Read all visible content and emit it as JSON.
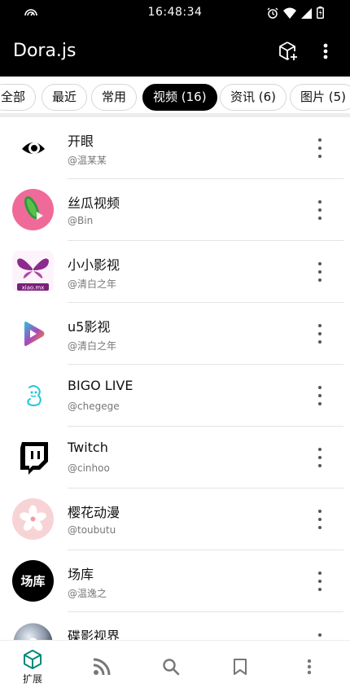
{
  "status_bar": {
    "time": "16:48:34"
  },
  "app_bar": {
    "title": "Dora.js",
    "cube_icon": "cube-plus-icon",
    "more_icon": "more-vert-icon"
  },
  "filters": [
    {
      "label": "全部",
      "active": false
    },
    {
      "label": "最近",
      "active": false
    },
    {
      "label": "常用",
      "active": false
    },
    {
      "label": "视频 (16)",
      "active": true
    },
    {
      "label": "资讯 (6)",
      "active": false
    },
    {
      "label": "图片 (5)",
      "active": false
    }
  ],
  "extensions": [
    {
      "name": "开眼",
      "author": "@温某某",
      "icon": "eye-logo"
    },
    {
      "name": "丝瓜视频",
      "author": "@Bin",
      "icon": "loofah-logo"
    },
    {
      "name": "小小影视",
      "author": "@清白之年",
      "icon": "butterfly-logo"
    },
    {
      "name": "u5影视",
      "author": "@清白之年",
      "icon": "play-gradient-logo"
    },
    {
      "name": "BIGO LIVE",
      "author": "@chegege",
      "icon": "bigo-logo"
    },
    {
      "name": "Twitch",
      "author": "@cinhoo",
      "icon": "twitch-logo"
    },
    {
      "name": "樱花动漫",
      "author": "@toubutu",
      "icon": "sakura-logo"
    },
    {
      "name": "场库",
      "author": "@温逸之",
      "icon": "changku-logo",
      "logo_text": "场库"
    },
    {
      "name": "碟影视界",
      "author": "",
      "icon": "disc-logo"
    }
  ],
  "bottom_nav": [
    {
      "label": "扩展",
      "icon": "extension-cube-icon",
      "active": true
    },
    {
      "label": "",
      "icon": "rss-icon",
      "active": false
    },
    {
      "label": "",
      "icon": "search-icon",
      "active": false
    },
    {
      "label": "",
      "icon": "bookmark-icon",
      "active": false
    },
    {
      "label": "",
      "icon": "more-vert-icon",
      "active": false
    }
  ],
  "colors": {
    "bar": "#000000",
    "accent": "#00897b",
    "chip_active": "#000000"
  }
}
